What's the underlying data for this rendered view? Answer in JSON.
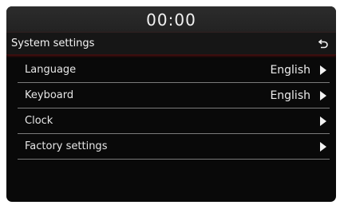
{
  "status_bar": {
    "time": "00:00"
  },
  "header": {
    "title": "System settings",
    "back_icon": "back-arrow-icon"
  },
  "menu": {
    "items": [
      {
        "label": "Language",
        "value": "English",
        "icon": "chevron-right-icon"
      },
      {
        "label": "Keyboard",
        "value": "English",
        "icon": "chevron-right-icon"
      },
      {
        "label": "Clock",
        "value": "",
        "icon": "chevron-right-icon"
      },
      {
        "label": "Factory settings",
        "value": "",
        "icon": "chevron-right-icon"
      }
    ]
  },
  "colors": {
    "background": "#090909",
    "status_bar": "#262626",
    "header_glow": "#961414",
    "text": "#e8e8e8",
    "divider": "#7a7a7a"
  }
}
